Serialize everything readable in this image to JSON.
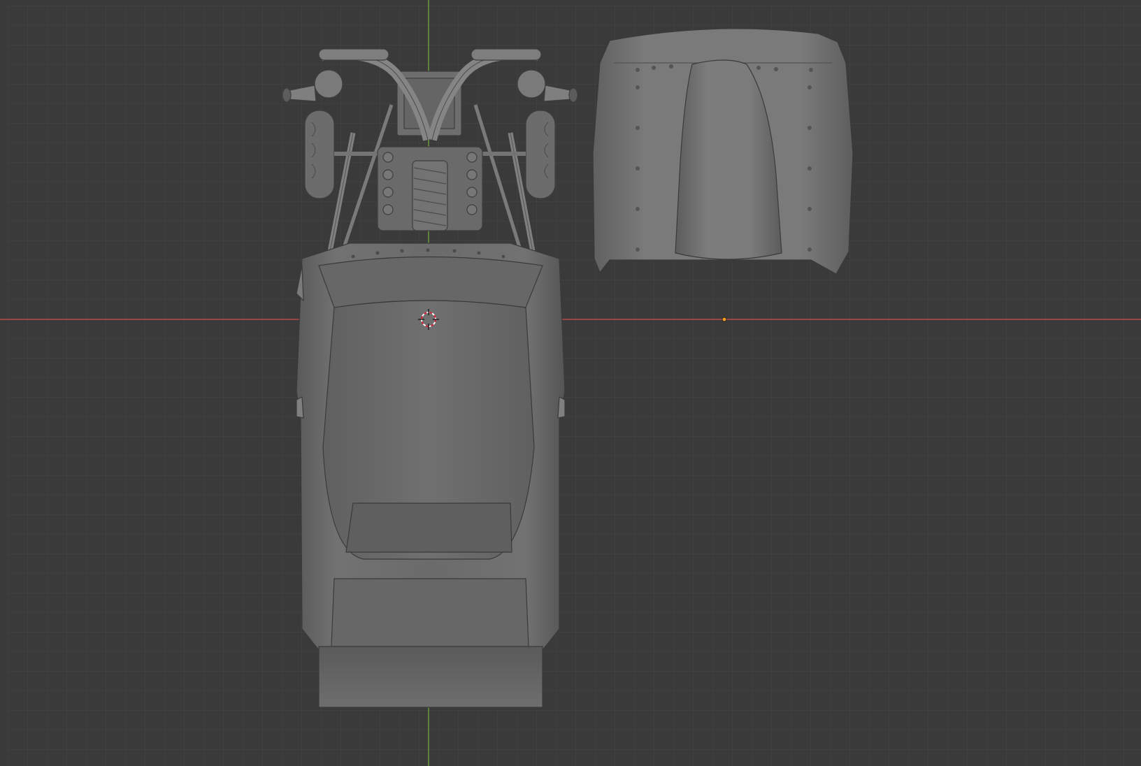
{
  "viewport": {
    "view": "top-orthographic",
    "background_color": "#3a3a3a",
    "grid_minor_color": "#444444",
    "grid_major_color": "#2e2e2e",
    "x_axis_color": "#c24a4a",
    "y_axis_color": "#6b9a3a",
    "cursor_color": "#d8243a",
    "origin_color": "#f0a020"
  },
  "objects": [
    {
      "name": "car-body",
      "material_color": "#6e6e6e"
    },
    {
      "name": "engine-frame",
      "material_color": "#7a7a7a"
    },
    {
      "name": "hood",
      "material_color": "#727272"
    }
  ]
}
